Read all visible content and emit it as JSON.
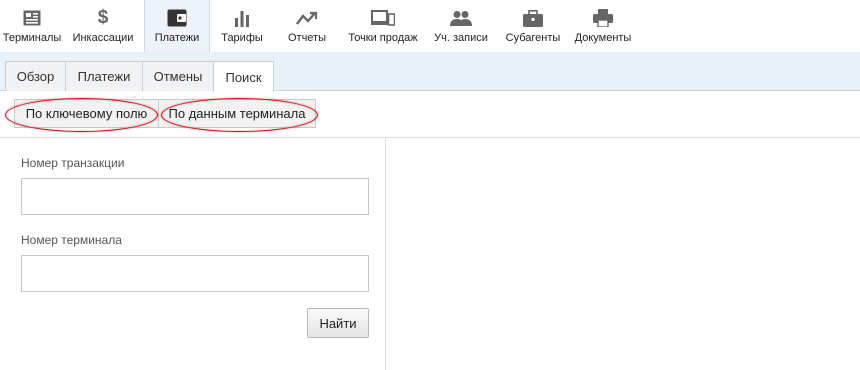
{
  "nav": {
    "items": [
      {
        "label": "Терминалы",
        "icon": "terminal-icon"
      },
      {
        "label": "Инкассации",
        "icon": "dollar-icon"
      },
      {
        "label": "Платежи",
        "icon": "wallet-icon"
      },
      {
        "label": "Тарифы",
        "icon": "bar-chart-icon"
      },
      {
        "label": "Отчеты",
        "icon": "trend-icon"
      },
      {
        "label": "Точки продаж",
        "icon": "devices-icon"
      },
      {
        "label": "Уч. записи",
        "icon": "users-icon"
      },
      {
        "label": "Субагенты",
        "icon": "briefcase-icon"
      },
      {
        "label": "Документы",
        "icon": "printer-icon"
      }
    ],
    "active_index": 2
  },
  "tabs": {
    "items": [
      "Обзор",
      "Платежи",
      "Отмены",
      "Поиск"
    ],
    "active_index": 3
  },
  "search_types": {
    "by_key_field": "По ключевому полю",
    "by_terminal_data": "По данным терминала"
  },
  "form": {
    "transaction_label": "Номер транзакции",
    "transaction_value": "",
    "terminal_label": "Номер терминала",
    "terminal_value": "",
    "submit_label": "Найти"
  },
  "colors": {
    "nav_active_bg": "#eef3f9",
    "tab_band_bg": "#e7f1fa",
    "highlight_ellipse": "#d0121b"
  }
}
